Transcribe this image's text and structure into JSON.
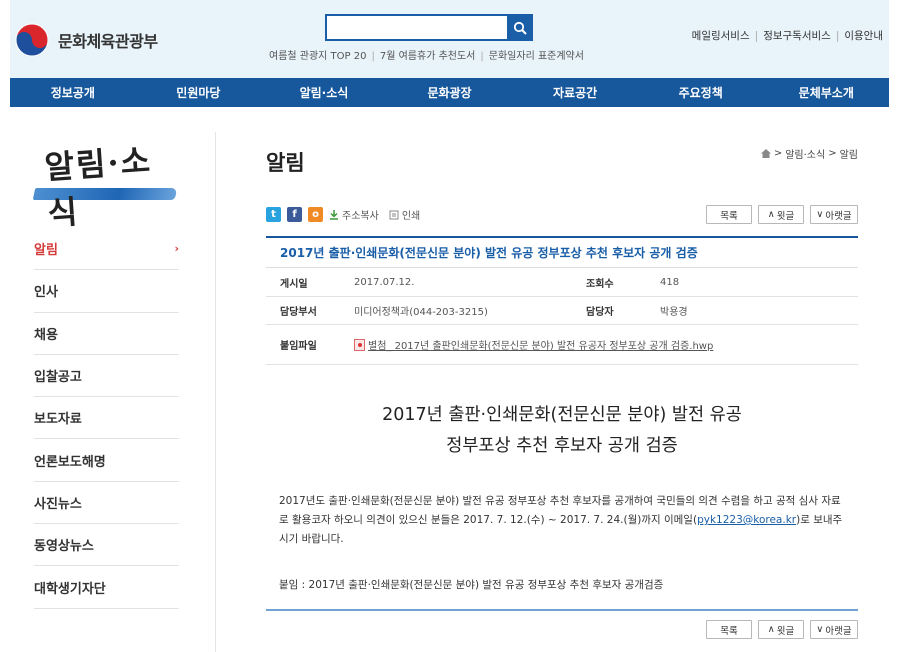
{
  "header": {
    "logo_text": "문화체육관광부",
    "search_placeholder": "",
    "keywords": [
      "여름철 관광지 TOP 20",
      "7월 여름휴가 추천도서",
      "문화일자리 표준계약서"
    ],
    "util_links": [
      "메일링서비스",
      "정보구독서비스",
      "이용안내"
    ]
  },
  "gnb": [
    "정보공개",
    "민원마당",
    "알림·소식",
    "문화광장",
    "자료공간",
    "주요정책",
    "문체부소개"
  ],
  "lnb": {
    "title": "알림·소식",
    "items": [
      "알림",
      "인사",
      "채용",
      "입찰공고",
      "보도자료",
      "언론보도해명",
      "사진뉴스",
      "동영상뉴스",
      "대학생기자단"
    ],
    "active_index": 0
  },
  "content": {
    "page_title": "알림",
    "breadcrumb": [
      "알림·소식",
      "알림"
    ],
    "share": {
      "copy_url": "주소복사",
      "print": "인쇄"
    },
    "buttons": {
      "list": "목록",
      "prev": "윗글",
      "next": "아랫글"
    },
    "article": {
      "title": "2017년 출판·인쇄문화(전문신문 분야) 발전 유공 정부포상 추천 후보자 공개 검증",
      "date_label": "게시일",
      "date": "2017.07.12.",
      "views_label": "조회수",
      "views": "418",
      "dept_label": "담당부서",
      "dept": "미디어정책과(044-203-3215)",
      "manager_label": "담당자",
      "manager": "박용경",
      "attach_label": "붙임파일",
      "attach": "별첨_ 2017년 출판인쇄문화(전문신문 분야) 발전 유공자 정부포상 공개 검증.hwp",
      "headline_1": "2017년 출판·인쇄문화(전문신문 분야) 발전 유공",
      "headline_2": "정부포상 추천 후보자 공개 검증",
      "body_part1": "2017년도 출판·인쇄문화(전문신문 분야) 발전 유공 정부포상 추천 후보자를 공개하여 국민들의 의견 수렴을 하고 공적 심사 자료로 활용코자 하오니 의견이 있으신 분들은 2017. 7. 12.(수) ~ 2017. 7. 24.(월)까지 이메일(",
      "body_email": "pyk1223@korea.kr",
      "body_part2": ")로 보내주시기 바랍니다.",
      "note": "붙임 :  2017년 출판·인쇄문화(전문신문 분야) 발전 유공 정부포상 추천 후보자 공개검증"
    }
  },
  "colors": {
    "brand_blue": "#17579b",
    "active_red": "#d33b3b",
    "header_bg": "#e8f3fa"
  }
}
